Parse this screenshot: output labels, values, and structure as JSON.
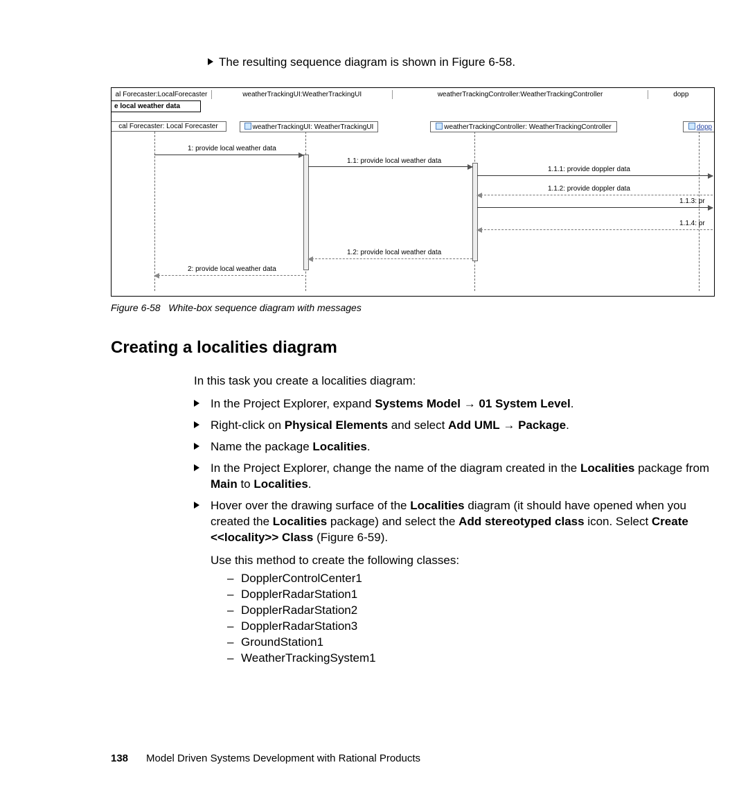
{
  "intro_bullet": "The resulting sequence diagram is shown in Figure 6-58.",
  "figure": {
    "top_row": {
      "c1": "al Forecaster:LocalForecaster",
      "c2": "weatherTrackingUI:WeatherTrackingUI",
      "c3": "weatherTrackingController:WeatherTrackingController",
      "c4": "dopp"
    },
    "second_row": "e local weather data",
    "lifeline1": "cal Forecaster: Local Forecaster",
    "lifeline2": "weatherTrackingUI: WeatherTrackingUI",
    "lifeline3": "weatherTrackingController: WeatherTrackingController",
    "lifeline4": "dopp",
    "msg1": "1: provide local weather data",
    "msg1_1": "1.1: provide local weather data",
    "msg1_1_1": "1.1.1: provide doppler data",
    "msg1_1_2": "1.1.2: provide doppler data",
    "msg1_1_3": "1.1.3: pr",
    "msg1_1_4": "1.1.4: pr",
    "msg1_2": "1.2: provide local weather data",
    "msg2": "2: provide local weather data"
  },
  "caption_label": "Figure 6-58",
  "caption_text": "White-box sequence diagram with messages",
  "section_heading": "Creating a localities diagram",
  "task_intro": "In this task you create a localities diagram:",
  "step1_pre": "In the Project Explorer, expand ",
  "step1_b1": "Systems Model",
  "step1_arrow": " → ",
  "step1_b2": "01 System Level",
  "step1_post": ".",
  "step2_pre": "Right-click on ",
  "step2_b1": "Physical Elements",
  "step2_mid": " and select ",
  "step2_b2": "Add UML",
  "step2_arrow": " → ",
  "step2_b3": "Package",
  "step2_post": ".",
  "step3_pre": "Name the package ",
  "step3_b1": "Localities",
  "step3_post": ".",
  "step4_pre": "In the Project Explorer, change the name of the diagram created in the ",
  "step4_b1": "Localities",
  "step4_mid1": " package from ",
  "step4_b2": "Main",
  "step4_mid2": " to ",
  "step4_b3": "Localities",
  "step4_post": ".",
  "step5_pre": "Hover over the drawing surface of the ",
  "step5_b1": "Localities",
  "step5_mid1": " diagram (it should have opened when you created the ",
  "step5_b2": "Localities",
  "step5_mid2": " package) and select the ",
  "step5_b3": "Add stereotyped class",
  "step5_mid3": " icon. Select ",
  "step5_b4": "Create <<locality>> Class",
  "step5_post": " (Figure 6-59).",
  "step5_sub_intro": "Use this method to create the following classes:",
  "classes": {
    "c1": "DopplerControlCenter1",
    "c2": "DopplerRadarStation1",
    "c3": "DopplerRadarStation2",
    "c4": "DopplerRadarStation3",
    "c5": "GroundStation1",
    "c6": "WeatherTrackingSystem1"
  },
  "footer_page": "138",
  "footer_title": "Model Driven Systems Development with Rational Products"
}
